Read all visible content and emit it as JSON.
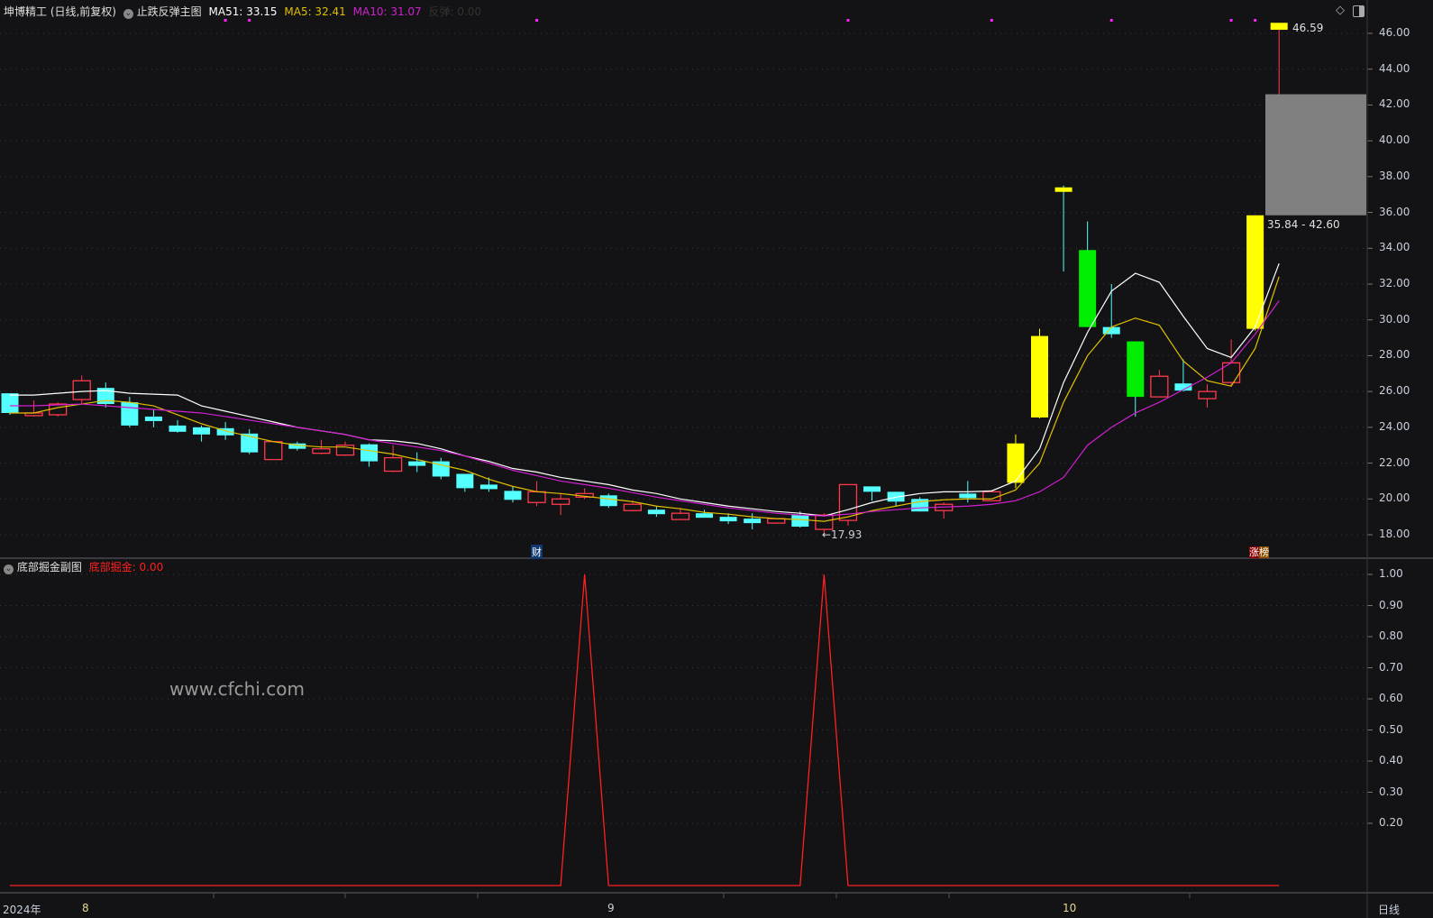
{
  "main_header": {
    "stock": "坤博精工 (日线,前复权)",
    "indicator_name": "止跌反弹主图",
    "ma_white": "MA51: 33.15",
    "ma5": "MA5: 32.41",
    "ma10": "MA10: 31.07",
    "rebound": "反弹: 0.00"
  },
  "sub_header": {
    "indicator_name": "底部掘金副图",
    "value": "底部掘金: 0.00"
  },
  "colors": {
    "background": "#131214",
    "up": "#ff3b4b",
    "down": "#54ffff",
    "big_up": "#ffff00",
    "big_down": "#00ee00",
    "ma_white": "#ffffff",
    "ma5": "#e0c000",
    "ma10": "#d020d0",
    "signal": "#ff2020",
    "gap_box": "#808080"
  },
  "price_axis": {
    "ticks": [
      "46.00",
      "44.00",
      "42.00",
      "40.00",
      "38.00",
      "36.00",
      "34.00",
      "32.00",
      "30.00",
      "28.00",
      "26.00",
      "24.00",
      "22.00",
      "20.00",
      "18.00"
    ],
    "range": [
      18,
      46
    ]
  },
  "sub_axis": {
    "ticks": [
      "1.00",
      "0.90",
      "0.80",
      "0.70",
      "0.60",
      "0.50",
      "0.40",
      "0.30",
      "0.20"
    ],
    "range": [
      0,
      1
    ]
  },
  "time_axis": {
    "year": "2024年",
    "months": [
      "8",
      "9",
      "10"
    ],
    "period": "日线"
  },
  "annotations": {
    "high_label": "46.59",
    "low_label": "←17.93",
    "gap_label": "35.84 - 42.60",
    "gap_range": [
      35.84,
      42.6
    ],
    "finance_tag": "财",
    "rank_tag_1": "涨",
    "rank_tag_2": "榜",
    "watermark": "www.cfchi.com"
  },
  "icons": {
    "diamond": "diamond-icon",
    "panel": "panel-toggle-icon",
    "collapse": "chevron-down-icon"
  },
  "chart_data": {
    "type": "candlestick",
    "candles": [
      {
        "o": 25.9,
        "h": 25.9,
        "l": 24.7,
        "c": 24.8,
        "t": "down"
      },
      {
        "o": 24.65,
        "h": 25.5,
        "l": 24.6,
        "c": 24.8,
        "t": "up"
      },
      {
        "o": 24.7,
        "h": 25.4,
        "l": 24.6,
        "c": 25.3,
        "t": "up"
      },
      {
        "o": 25.55,
        "h": 26.9,
        "l": 25.3,
        "c": 26.6,
        "t": "up"
      },
      {
        "o": 26.2,
        "h": 26.5,
        "l": 25.1,
        "c": 25.3,
        "t": "down"
      },
      {
        "o": 25.4,
        "h": 25.7,
        "l": 24.0,
        "c": 24.1,
        "t": "down"
      },
      {
        "o": 24.6,
        "h": 25.0,
        "l": 24.0,
        "c": 24.35,
        "t": "down"
      },
      {
        "o": 24.1,
        "h": 24.4,
        "l": 23.7,
        "c": 23.75,
        "t": "down"
      },
      {
        "o": 24.0,
        "h": 24.1,
        "l": 23.2,
        "c": 23.6,
        "t": "down"
      },
      {
        "o": 23.95,
        "h": 24.3,
        "l": 23.3,
        "c": 23.55,
        "t": "down"
      },
      {
        "o": 23.65,
        "h": 23.9,
        "l": 22.5,
        "c": 22.6,
        "t": "down"
      },
      {
        "o": 22.2,
        "h": 23.2,
        "l": 22.2,
        "c": 23.2,
        "t": "up"
      },
      {
        "o": 23.1,
        "h": 23.2,
        "l": 22.7,
        "c": 22.8,
        "t": "down"
      },
      {
        "o": 22.55,
        "h": 23.3,
        "l": 22.5,
        "c": 22.8,
        "t": "up"
      },
      {
        "o": 22.45,
        "h": 23.2,
        "l": 22.4,
        "c": 23.0,
        "t": "up"
      },
      {
        "o": 23.05,
        "h": 23.1,
        "l": 21.8,
        "c": 22.1,
        "t": "down"
      },
      {
        "o": 21.55,
        "h": 23.0,
        "l": 21.5,
        "c": 22.3,
        "t": "up"
      },
      {
        "o": 22.1,
        "h": 22.6,
        "l": 21.5,
        "c": 22.05,
        "t": "down"
      },
      {
        "o": 22.1,
        "h": 22.3,
        "l": 21.1,
        "c": 21.25,
        "t": "down"
      },
      {
        "o": 21.4,
        "h": 21.4,
        "l": 20.4,
        "c": 20.6,
        "t": "down"
      },
      {
        "o": 20.8,
        "h": 21.2,
        "l": 20.4,
        "c": 20.55,
        "t": "down"
      },
      {
        "o": 20.45,
        "h": 20.7,
        "l": 19.8,
        "c": 19.95,
        "t": "down"
      },
      {
        "o": 19.8,
        "h": 21.0,
        "l": 19.6,
        "c": 20.4,
        "t": "up"
      },
      {
        "o": 19.7,
        "h": 20.3,
        "l": 19.1,
        "c": 20.0,
        "t": "up"
      },
      {
        "o": 20.1,
        "h": 20.6,
        "l": 20.0,
        "c": 20.3,
        "t": "up"
      },
      {
        "o": 20.2,
        "h": 20.3,
        "l": 19.5,
        "c": 19.6,
        "t": "down"
      },
      {
        "o": 19.35,
        "h": 19.9,
        "l": 19.3,
        "c": 19.7,
        "t": "up"
      },
      {
        "o": 19.4,
        "h": 19.6,
        "l": 19.0,
        "c": 19.2,
        "t": "down"
      },
      {
        "o": 18.85,
        "h": 19.5,
        "l": 18.85,
        "c": 19.2,
        "t": "up"
      },
      {
        "o": 19.2,
        "h": 19.4,
        "l": 19.0,
        "c": 19.1,
        "t": "down"
      },
      {
        "o": 19.0,
        "h": 19.2,
        "l": 18.6,
        "c": 18.8,
        "t": "down"
      },
      {
        "o": 18.9,
        "h": 19.2,
        "l": 18.3,
        "c": 18.75,
        "t": "down"
      },
      {
        "o": 18.65,
        "h": 18.9,
        "l": 18.65,
        "c": 18.9,
        "t": "up"
      },
      {
        "o": 19.1,
        "h": 19.3,
        "l": 18.4,
        "c": 18.45,
        "t": "down"
      },
      {
        "o": 18.3,
        "h": 19.2,
        "l": 17.93,
        "c": 19.1,
        "t": "up"
      },
      {
        "o": 18.8,
        "h": 20.8,
        "l": 18.5,
        "c": 20.8,
        "t": "up"
      },
      {
        "o": 20.7,
        "h": 20.7,
        "l": 19.9,
        "c": 20.4,
        "t": "down"
      },
      {
        "o": 20.4,
        "h": 20.4,
        "l": 19.6,
        "c": 19.85,
        "t": "down"
      },
      {
        "o": 20.0,
        "h": 20.1,
        "l": 19.3,
        "c": 19.3,
        "t": "down"
      },
      {
        "o": 19.35,
        "h": 19.8,
        "l": 18.9,
        "c": 19.7,
        "t": "up"
      },
      {
        "o": 20.3,
        "h": 21.0,
        "l": 19.8,
        "c": 20.25,
        "t": "down"
      },
      {
        "o": 19.9,
        "h": 20.5,
        "l": 19.9,
        "c": 20.4,
        "t": "up"
      },
      {
        "o": 20.9,
        "h": 23.6,
        "l": 20.6,
        "c": 23.1,
        "t": "big_up"
      },
      {
        "o": 24.55,
        "h": 29.5,
        "l": 24.5,
        "c": 29.1,
        "t": "big_up"
      },
      {
        "o": 37.4,
        "h": 37.5,
        "l": 32.7,
        "c": 37.3,
        "t": "big_up"
      },
      {
        "o": 33.9,
        "h": 35.5,
        "l": 29.6,
        "c": 29.6,
        "t": "big_down"
      },
      {
        "o": 29.6,
        "h": 32.0,
        "l": 29.0,
        "c": 29.2,
        "t": "down"
      },
      {
        "o": 28.8,
        "h": 28.8,
        "l": 24.6,
        "c": 25.7,
        "t": "big_down"
      },
      {
        "o": 25.7,
        "h": 27.2,
        "l": 25.7,
        "c": 26.85,
        "t": "up"
      },
      {
        "o": 26.45,
        "h": 27.8,
        "l": 26.0,
        "c": 26.05,
        "t": "down"
      },
      {
        "o": 25.6,
        "h": 26.4,
        "l": 25.1,
        "c": 26.0,
        "t": "up"
      },
      {
        "o": 26.5,
        "h": 28.9,
        "l": 26.3,
        "c": 27.6,
        "t": "up"
      },
      {
        "o": 29.5,
        "h": 35.84,
        "l": 29.4,
        "c": 35.84,
        "t": "big_up"
      },
      {
        "o": 46.2,
        "h": 46.59,
        "l": 42.6,
        "c": 46.59,
        "t": "big_up"
      }
    ],
    "ma_white": [
      25.8,
      25.8,
      25.9,
      26.0,
      26.05,
      25.9,
      25.85,
      25.8,
      25.2,
      24.9,
      24.6,
      24.3,
      24.0,
      23.8,
      23.6,
      23.3,
      23.25,
      23.1,
      22.8,
      22.4,
      22.1,
      21.7,
      21.5,
      21.2,
      21.0,
      20.8,
      20.5,
      20.3,
      20.0,
      19.8,
      19.6,
      19.45,
      19.3,
      19.2,
      19.05,
      19.4,
      19.8,
      20.1,
      20.3,
      20.4,
      20.4,
      20.45,
      21.0,
      22.8,
      26.5,
      29.3,
      31.6,
      32.6,
      32.1,
      30.2,
      28.4,
      27.9,
      29.6,
      33.15
    ],
    "ma5": [
      24.8,
      24.8,
      25.1,
      25.3,
      25.5,
      25.4,
      25.2,
      24.7,
      24.2,
      23.8,
      23.5,
      23.2,
      23.0,
      22.9,
      22.9,
      22.7,
      22.5,
      22.2,
      21.9,
      21.6,
      21.1,
      20.7,
      20.4,
      20.3,
      20.15,
      20.0,
      19.85,
      19.6,
      19.45,
      19.25,
      19.15,
      19.0,
      18.9,
      18.85,
      18.75,
      19.0,
      19.35,
      19.6,
      19.85,
      19.95,
      20.0,
      20.0,
      20.5,
      22.0,
      25.4,
      28.0,
      29.6,
      30.1,
      29.7,
      27.7,
      26.6,
      26.3,
      28.4,
      32.41
    ],
    "ma10": [
      25.2,
      25.2,
      25.25,
      25.3,
      25.2,
      25.1,
      25.0,
      24.9,
      24.8,
      24.6,
      24.4,
      24.2,
      24.0,
      23.8,
      23.6,
      23.3,
      23.1,
      22.9,
      22.7,
      22.4,
      22.0,
      21.6,
      21.3,
      21.0,
      20.8,
      20.6,
      20.35,
      20.1,
      19.9,
      19.7,
      19.5,
      19.35,
      19.2,
      19.1,
      19.05,
      19.15,
      19.3,
      19.4,
      19.5,
      19.55,
      19.6,
      19.7,
      19.9,
      20.4,
      21.2,
      23.0,
      24.0,
      24.8,
      25.4,
      26.1,
      26.8,
      27.6,
      29.2,
      31.07
    ],
    "signal_dots": [
      9,
      10,
      22,
      35,
      41,
      46,
      51,
      52
    ],
    "bottom_gold": [
      0,
      0,
      0,
      0,
      0,
      0,
      0,
      0,
      0,
      0,
      0,
      0,
      0,
      0,
      0,
      0,
      0,
      0,
      0,
      0,
      0,
      0,
      0,
      0,
      1,
      0,
      0,
      0,
      0,
      0,
      0,
      0,
      0,
      0,
      1,
      0,
      0,
      0,
      0,
      0,
      0,
      0,
      0,
      0,
      0,
      0,
      0,
      0,
      0,
      0,
      0,
      0,
      0,
      0
    ]
  }
}
